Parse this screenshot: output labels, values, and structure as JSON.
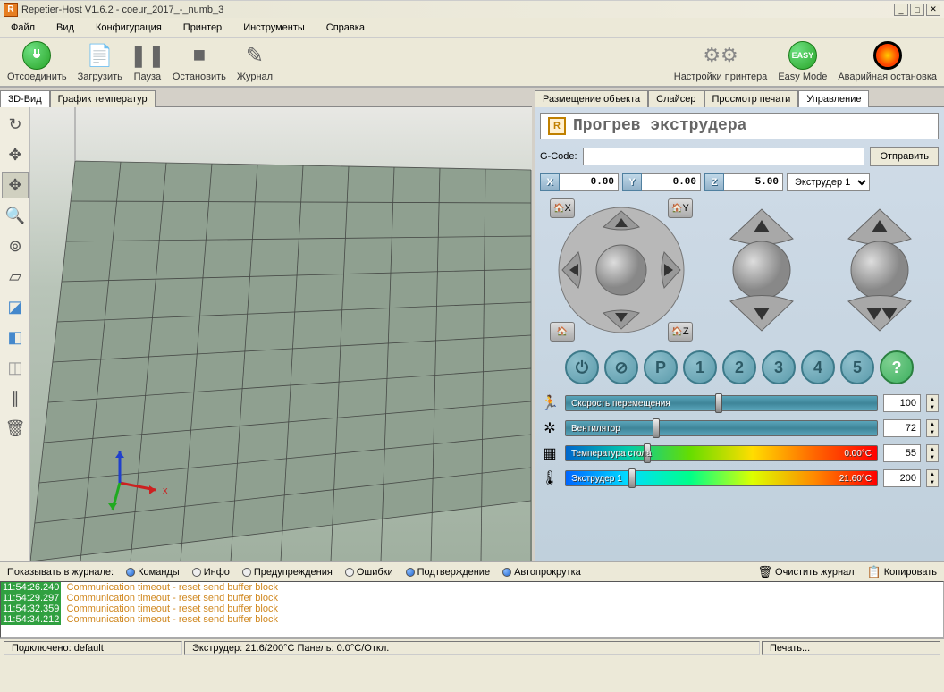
{
  "title": "Repetier-Host V1.6.2 - coeur_2017_-_numb_3",
  "menu": [
    "Файл",
    "Вид",
    "Конфигурация",
    "Принтер",
    "Инструменты",
    "Справка"
  ],
  "toolbar": {
    "disconnect": "Отсоединить",
    "load": "Загрузить",
    "pause": "Пауза",
    "stop": "Остановить",
    "journal": "Журнал",
    "settings": "Настройки принтера",
    "easy": "Easy Mode",
    "easylabel": "EASY",
    "emergency": "Аварийная остановка"
  },
  "left_tabs": [
    "3D-Вид",
    "График температур"
  ],
  "right_tabs": [
    "Размещение объекта",
    "Слайсер",
    "Просмотр печати",
    "Управление"
  ],
  "ctrl": {
    "header": "Прогрев экструдера",
    "headic": "R",
    "gcode_label": "G-Code:",
    "send_btn": "Отправить",
    "x": "0.00",
    "y": "0.00",
    "z": "5.00",
    "ext_sel": "Экструдер 1",
    "P": "P",
    "nums": [
      "1",
      "2",
      "3",
      "4",
      "5"
    ],
    "q": "?",
    "slider_speed": "Скорость перемещения",
    "slider_fan": "Вентилятор",
    "slider_bed": "Температура стола",
    "slider_ext": "Экструдер 1",
    "bed_val": "0.00°C",
    "ext_val": "21.60°C",
    "speed_num": "100",
    "fan_num": "72",
    "bed_num": "55",
    "ext_num": "200"
  },
  "homes": {
    "x": "X",
    "y": "Y",
    "z": "Z"
  },
  "log_filter": {
    "label": "Показывать в журнале:",
    "commands": "Команды",
    "info": "Инфо",
    "warnings": "Предупреждения",
    "errors": "Ошибки",
    "ack": "Подтверждение",
    "autoscroll": "Автопрокрутка",
    "clear": "Очистить журнал",
    "copy": "Копировать"
  },
  "log_lines": [
    {
      "ts": "11:54:26.240",
      "msg": "Communication timeout - reset send buffer block"
    },
    {
      "ts": "11:54:29.297",
      "msg": "Communication timeout - reset send buffer block"
    },
    {
      "ts": "11:54:32.359",
      "msg": "Communication timeout - reset send buffer block"
    },
    {
      "ts": "11:54:34.212",
      "msg": "Communication timeout - reset send buffer block"
    }
  ],
  "status": {
    "conn": "Подключено: default",
    "extruder": "Экструдер: 21.6/200°C Панель: 0.0°C/Откл.",
    "print": "Печать..."
  }
}
